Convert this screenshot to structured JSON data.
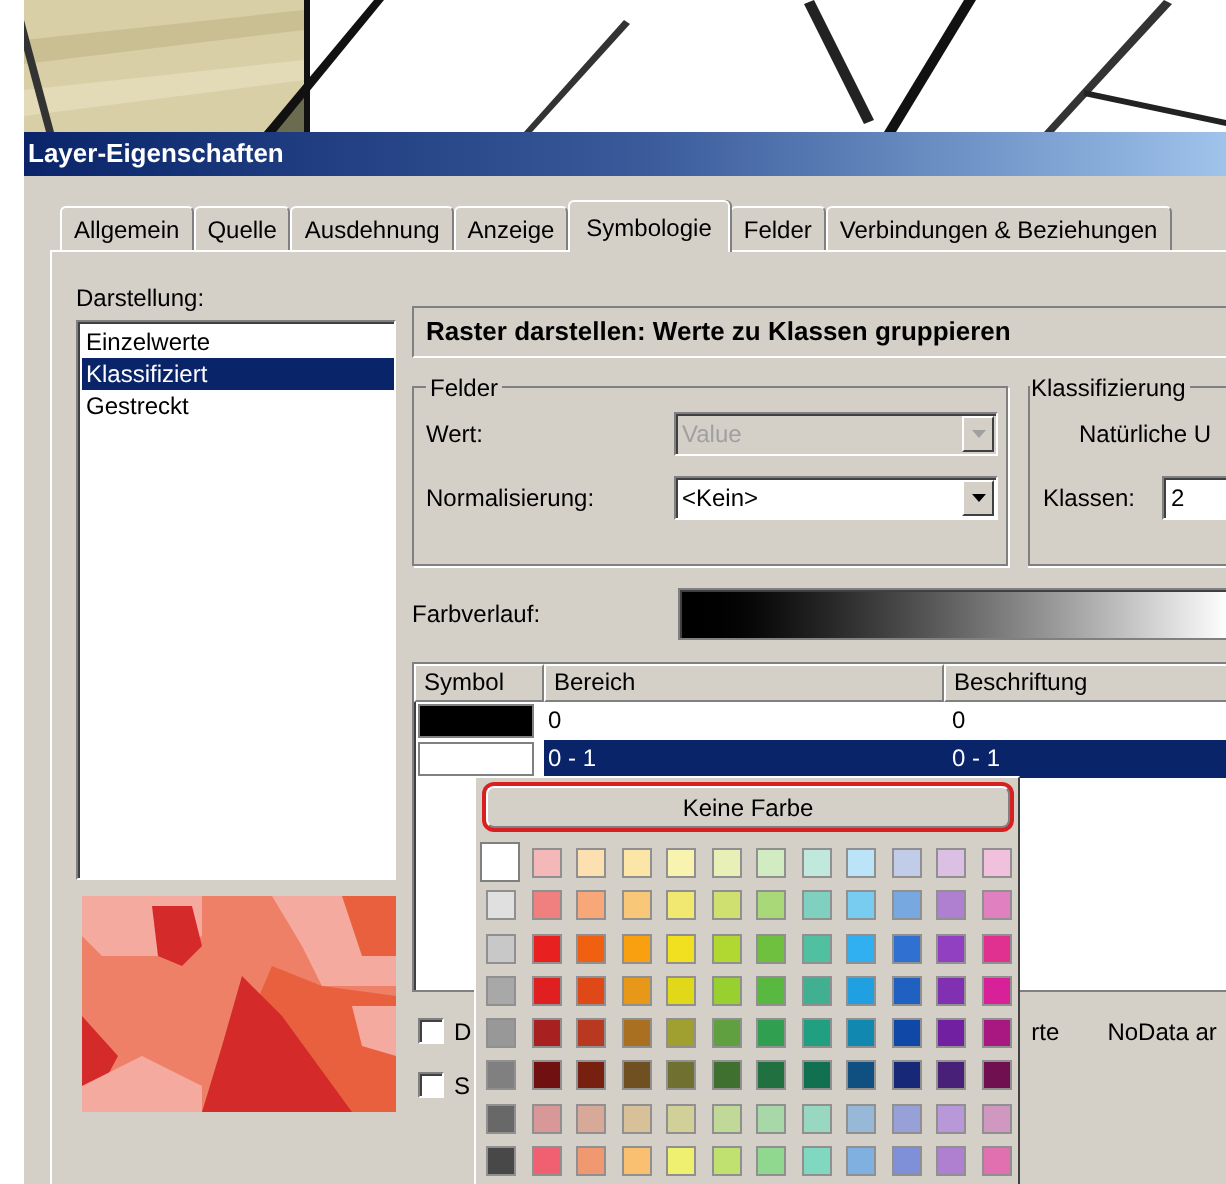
{
  "window": {
    "title": "Layer-Eigenschaften"
  },
  "tabs": [
    {
      "label": "Allgemein",
      "selected": false
    },
    {
      "label": "Quelle",
      "selected": false
    },
    {
      "label": "Ausdehnung",
      "selected": false
    },
    {
      "label": "Anzeige",
      "selected": false
    },
    {
      "label": "Symbologie",
      "selected": true
    },
    {
      "label": "Felder",
      "selected": false
    },
    {
      "label": "Verbindungen & Beziehungen",
      "selected": false
    }
  ],
  "darstellung": {
    "label": "Darstellung:",
    "items": [
      {
        "label": "Einzelwerte",
        "selected": false
      },
      {
        "label": "Klassifiziert",
        "selected": true
      },
      {
        "label": "Gestreckt",
        "selected": false
      }
    ]
  },
  "heading": "Raster darstellen: Werte zu Klassen gruppieren",
  "felder": {
    "title": "Felder",
    "fields": [
      {
        "label": "Wert:",
        "value": "Value",
        "disabled": true
      },
      {
        "label": "Normalisierung:",
        "value": "<Kein>",
        "disabled": false
      }
    ]
  },
  "klassifizierung": {
    "title": "Klassifizierung",
    "method": "Natürliche U",
    "classes_label": "Klassen:",
    "classes_value": "2"
  },
  "farbverlauf": {
    "label": "Farbverlauf:"
  },
  "table": {
    "columns": [
      "Symbol",
      "Bereich",
      "Beschriftung"
    ],
    "rows": [
      {
        "color": "#000000",
        "range": "0",
        "label": "0",
        "selected": false
      },
      {
        "color": "#ffffff",
        "range": "0 - 1",
        "label": "0 - 1",
        "selected": true
      }
    ]
  },
  "checkboxes": [
    {
      "label": "D",
      "checked": false
    },
    {
      "label": "S",
      "checked": false
    }
  ],
  "partial_label": "rte",
  "nodata_label": "NoData ar",
  "color_popup": {
    "no_color_button": "Keine Farbe",
    "swatches": [
      {
        "color": "#ffffff",
        "selected": true
      },
      {
        "color": "#f4b8b8",
        "selected": false
      },
      {
        "color": "#fce0b0",
        "selected": false
      },
      {
        "color": "#fbe6a8",
        "selected": false
      },
      {
        "color": "#f8f4b0",
        "selected": false
      },
      {
        "color": "#e8f0b8",
        "selected": false
      },
      {
        "color": "#d0ecc0",
        "selected": false
      },
      {
        "color": "#c0e8dc",
        "selected": false
      },
      {
        "color": "#bce4f8",
        "selected": false
      },
      {
        "color": "#c0cce8",
        "selected": false
      },
      {
        "color": "#dcc0e4",
        "selected": false
      },
      {
        "color": "#f0c0dc",
        "selected": false
      },
      {
        "color": "#e0e0e0",
        "selected": false
      },
      {
        "color": "#f08080",
        "selected": false
      },
      {
        "color": "#f8a878",
        "selected": false
      },
      {
        "color": "#f8c878",
        "selected": false
      },
      {
        "color": "#f0e870",
        "selected": false
      },
      {
        "color": "#d0e070",
        "selected": false
      },
      {
        "color": "#a8d878",
        "selected": false
      },
      {
        "color": "#80d0c0",
        "selected": false
      },
      {
        "color": "#78ccf0",
        "selected": false
      },
      {
        "color": "#78a8e0",
        "selected": false
      },
      {
        "color": "#b080d0",
        "selected": false
      },
      {
        "color": "#e080c0",
        "selected": false
      },
      {
        "color": "#c8c8c8",
        "selected": false
      },
      {
        "color": "#e82020",
        "selected": false
      },
      {
        "color": "#f06010",
        "selected": false
      },
      {
        "color": "#f8a010",
        "selected": false
      },
      {
        "color": "#f0e020",
        "selected": false
      },
      {
        "color": "#b0d830",
        "selected": false
      },
      {
        "color": "#70c040",
        "selected": false
      },
      {
        "color": "#50c0a0",
        "selected": false
      },
      {
        "color": "#30b0f0",
        "selected": false
      },
      {
        "color": "#3070d0",
        "selected": false
      },
      {
        "color": "#9040c0",
        "selected": false
      },
      {
        "color": "#e03090",
        "selected": false
      },
      {
        "color": "#a8a8a8",
        "selected": false
      },
      {
        "color": "#e02020",
        "selected": false
      },
      {
        "color": "#e04818",
        "selected": false
      },
      {
        "color": "#e89818",
        "selected": false
      },
      {
        "color": "#e0d818",
        "selected": false
      },
      {
        "color": "#98d030",
        "selected": false
      },
      {
        "color": "#58b840",
        "selected": false
      },
      {
        "color": "#40b090",
        "selected": false
      },
      {
        "color": "#20a0e0",
        "selected": false
      },
      {
        "color": "#2060c0",
        "selected": false
      },
      {
        "color": "#8030b0",
        "selected": false
      },
      {
        "color": "#d82098",
        "selected": false
      },
      {
        "color": "#989898",
        "selected": false
      },
      {
        "color": "#a82020",
        "selected": false
      },
      {
        "color": "#b83820",
        "selected": false
      },
      {
        "color": "#a87020",
        "selected": false
      },
      {
        "color": "#a0a030",
        "selected": false
      },
      {
        "color": "#60a040",
        "selected": false
      },
      {
        "color": "#30a050",
        "selected": false
      },
      {
        "color": "#20a080",
        "selected": false
      },
      {
        "color": "#1088b0",
        "selected": false
      },
      {
        "color": "#1048a8",
        "selected": false
      },
      {
        "color": "#7020a0",
        "selected": false
      },
      {
        "color": "#a81880",
        "selected": false
      },
      {
        "color": "#808080",
        "selected": false
      },
      {
        "color": "#701010",
        "selected": false
      },
      {
        "color": "#782010",
        "selected": false
      },
      {
        "color": "#705020",
        "selected": false
      },
      {
        "color": "#707030",
        "selected": false
      },
      {
        "color": "#407030",
        "selected": false
      },
      {
        "color": "#207040",
        "selected": false
      },
      {
        "color": "#107050",
        "selected": false
      },
      {
        "color": "#105080",
        "selected": false
      },
      {
        "color": "#182878",
        "selected": false
      },
      {
        "color": "#482078",
        "selected": false
      },
      {
        "color": "#701050",
        "selected": false
      },
      {
        "color": "#686868",
        "selected": false
      },
      {
        "color": "#d89898",
        "selected": false
      },
      {
        "color": "#d8a898",
        "selected": false
      },
      {
        "color": "#d8c098",
        "selected": false
      },
      {
        "color": "#d0d098",
        "selected": false
      },
      {
        "color": "#c0d898",
        "selected": false
      },
      {
        "color": "#a8d8a8",
        "selected": false
      },
      {
        "color": "#98d8c0",
        "selected": false
      },
      {
        "color": "#98b8d8",
        "selected": false
      },
      {
        "color": "#98a0d8",
        "selected": false
      },
      {
        "color": "#b898d8",
        "selected": false
      },
      {
        "color": "#d098c0",
        "selected": false
      },
      {
        "color": "#484848",
        "selected": false
      },
      {
        "color": "#f06070",
        "selected": false
      },
      {
        "color": "#f09870",
        "selected": false
      },
      {
        "color": "#f8c070",
        "selected": false
      },
      {
        "color": "#f0f070",
        "selected": false
      },
      {
        "color": "#c0e070",
        "selected": false
      },
      {
        "color": "#90d890",
        "selected": false
      },
      {
        "color": "#80d8c0",
        "selected": false
      },
      {
        "color": "#80b0e0",
        "selected": false
      },
      {
        "color": "#8090d8",
        "selected": false
      },
      {
        "color": "#b080d0",
        "selected": false
      },
      {
        "color": "#e070b0",
        "selected": false
      }
    ]
  }
}
